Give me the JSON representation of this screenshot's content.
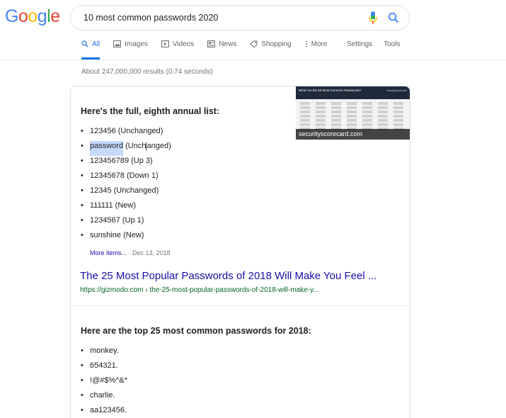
{
  "logo": {
    "letters": [
      "G",
      "o",
      "o",
      "g",
      "l",
      "e"
    ],
    "colors": [
      "#4285F4",
      "#EA4335",
      "#FBBC05",
      "#4285F4",
      "#34A853",
      "#EA4335"
    ]
  },
  "search": {
    "query": "10 most common passwords 2020",
    "mic_icon": "microphone-icon",
    "search_icon": "search-icon"
  },
  "tabs": [
    {
      "label": "All",
      "icon": "search-icon",
      "active": true
    },
    {
      "label": "Images",
      "icon": "image-icon"
    },
    {
      "label": "Videos",
      "icon": "video-icon"
    },
    {
      "label": "News",
      "icon": "news-icon"
    },
    {
      "label": "Shopping",
      "icon": "tag-icon"
    },
    {
      "label": "More",
      "icon": "more-vertical-icon"
    }
  ],
  "tools": {
    "settings": "Settings",
    "tools": "Tools"
  },
  "stats": "About 247,000,000 results (0.74 seconds)",
  "snippet1": {
    "thumbnail": {
      "title": "What Are the 50 Most Common Passwords?",
      "brand": "SecurityScorecard",
      "caption": "securityscorecard.com"
    },
    "heading": "Here's the full, eighth annual list:",
    "items": [
      "123456 (Unchanged)",
      "password (Unchanged)",
      "123456789 (Up 3)",
      "12345678 (Down 1)",
      "12345 (Unchanged)",
      "111111 (New)",
      "1234567 (Up 1)",
      "sunshine (New)"
    ],
    "selected_word": "password",
    "more_label": "More items...",
    "date": "Dec 13, 2018",
    "result_title": "The 25 Most Popular Passwords of 2018 Will Make You Feel ...",
    "result_url": "https://gizmodo.com › the-25-most-popular-passwords-of-2018-will-make-y..."
  },
  "snippet2": {
    "heading": "Here are the top 25 most common passwords for 2018:",
    "items": [
      "monkey.",
      "654321.",
      "!@#$%^&*",
      "charlie.",
      "aa123456."
    ]
  },
  "colors": {
    "link": "#1a0dab",
    "url": "#006621",
    "accent": "#1a73e8",
    "highlight": "#c6dafc"
  }
}
